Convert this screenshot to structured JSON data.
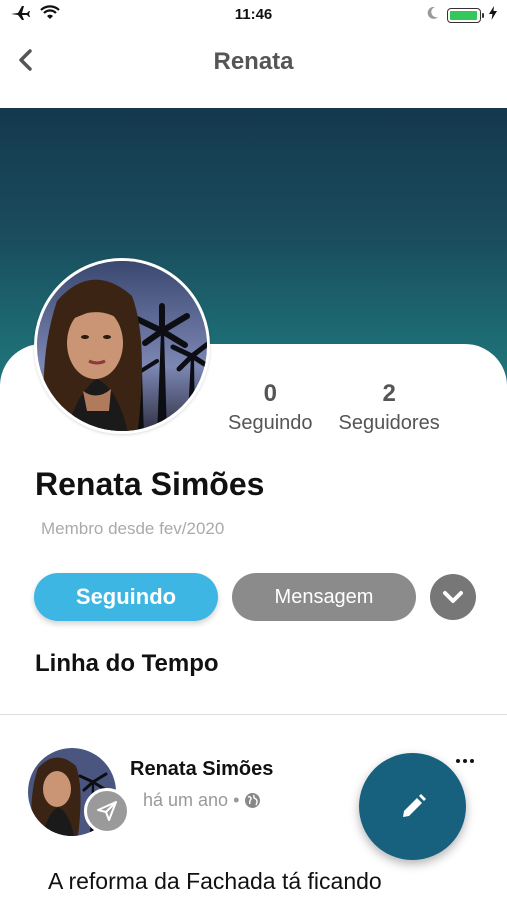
{
  "status_bar": {
    "time": "11:46",
    "battery_level": 0.95,
    "icons": [
      "airplane-icon",
      "wifi-icon",
      "moon-icon",
      "battery-icon",
      "charging-bolt-icon"
    ]
  },
  "nav": {
    "title": "Renata",
    "back_icon": "chevron-left-icon"
  },
  "profile": {
    "name": "Renata Simões",
    "member_since": "Membro desde fev/2020",
    "stats": [
      {
        "value": "0",
        "label": "Seguindo"
      },
      {
        "value": "2",
        "label": "Seguidores"
      }
    ]
  },
  "actions": {
    "following_label": "Seguindo",
    "message_label": "Mensagem",
    "more_icon": "chevron-down-icon"
  },
  "timeline": {
    "title": "Linha do Tempo"
  },
  "post": {
    "author": "Renata Simões",
    "time": "há um ano",
    "separator": "•",
    "visibility_icon": "globe-icon",
    "badge_icon": "paper-plane-icon",
    "text": "A reforma da Fachada tá ficando"
  },
  "fab": {
    "icon": "pencil-icon"
  },
  "colors": {
    "accent": "#3db6e3",
    "fab": "#17607e",
    "cover_top": "#14384d",
    "cover_bottom": "#1f7a7e"
  }
}
